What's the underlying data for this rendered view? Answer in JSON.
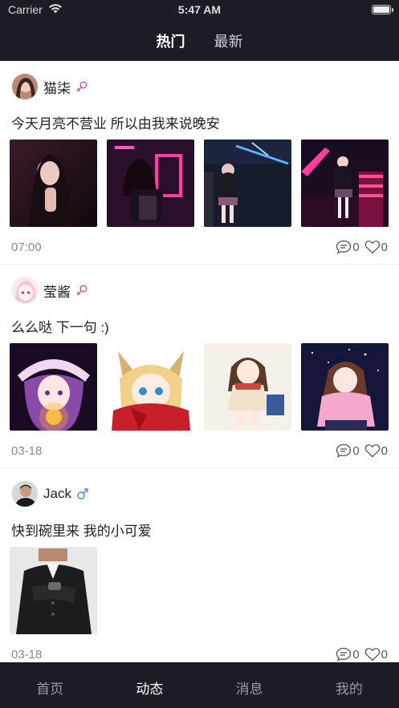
{
  "status_bar": {
    "carrier": "Carrier",
    "time": "5:47 AM"
  },
  "top_tabs": [
    {
      "label": "热门",
      "active": true
    },
    {
      "label": "最新",
      "active": false
    }
  ],
  "posts": [
    {
      "username": "猫柒",
      "gender": "female",
      "text": "今天月亮不营业 所以由我来说晚安",
      "image_count": 4,
      "time": "07:00",
      "comments": "0",
      "likes": "0"
    },
    {
      "username": "莹酱",
      "gender": "female",
      "text": "么么哒 下一句 :)",
      "image_count": 4,
      "time": "03-18",
      "comments": "0",
      "likes": "0"
    },
    {
      "username": "Jack",
      "gender": "male",
      "text": "快到碗里来 我的小可爱",
      "image_count": 1,
      "time": "03-18",
      "comments": "0",
      "likes": "0"
    }
  ],
  "bottom_tabs": [
    {
      "label": "首页",
      "active": false
    },
    {
      "label": "动态",
      "active": true
    },
    {
      "label": "消息",
      "active": false
    },
    {
      "label": "我的",
      "active": false
    }
  ],
  "colors": {
    "bar": "#1c1c24",
    "female": "#d24fa0",
    "male": "#3c8ee6"
  }
}
